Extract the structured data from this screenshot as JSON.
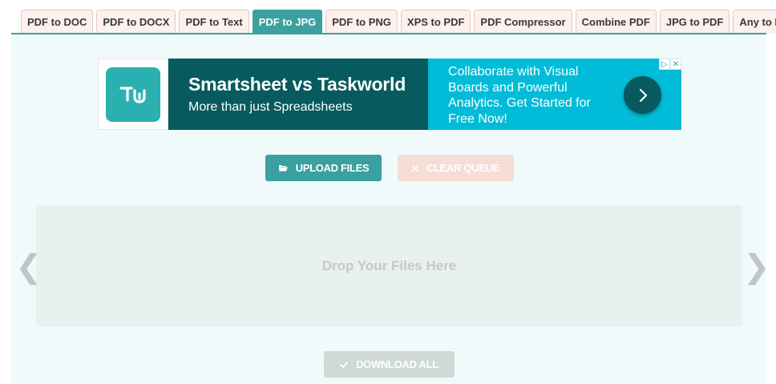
{
  "tabs": [
    {
      "label": "PDF to DOC",
      "active": false
    },
    {
      "label": "PDF to DOCX",
      "active": false
    },
    {
      "label": "PDF to Text",
      "active": false
    },
    {
      "label": "PDF to JPG",
      "active": true
    },
    {
      "label": "PDF to PNG",
      "active": false
    },
    {
      "label": "XPS to PDF",
      "active": false
    },
    {
      "label": "PDF Compressor",
      "active": false
    },
    {
      "label": "Combine PDF",
      "active": false
    },
    {
      "label": "JPG to PDF",
      "active": false
    },
    {
      "label": "Any to PDF",
      "active": false
    }
  ],
  "ad": {
    "title": "Smartsheet vs Taskworld",
    "subtitle": "More than just Spreadsheets",
    "description": "Collaborate with Visual Boards and Powerful Analytics. Get Started for Free Now!",
    "badge_adchoices": "▷",
    "badge_close": "✕"
  },
  "actions": {
    "upload_label": "UPLOAD FILES",
    "clear_label": "CLEAR QUEUE",
    "download_label": "DOWNLOAD ALL"
  },
  "drop_zone": {
    "text": "Drop Your Files Here"
  },
  "nav": {
    "prev": "❮",
    "next": "❯"
  },
  "colors": {
    "accent": "#3aa0a0",
    "tab_bg": "#fdf0ed",
    "panel_bg": "#f0fafa",
    "ad_dark": "#075a5e",
    "ad_light": "#00bcd8"
  },
  "icons": {
    "upload": "folder-open-icon",
    "clear": "close-icon",
    "download": "checkmark-icon",
    "ad_arrow": "chevron-right-icon"
  }
}
